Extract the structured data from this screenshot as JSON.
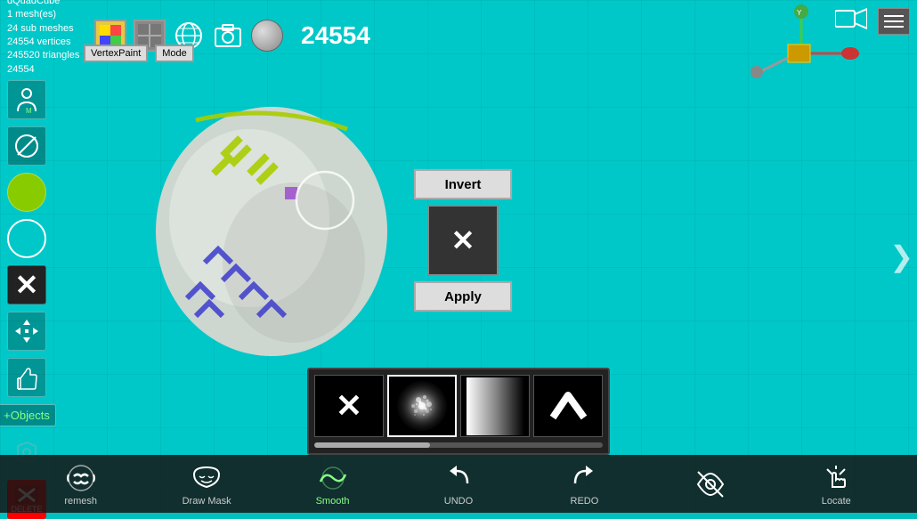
{
  "app": {
    "title": "dQuadCube",
    "mesh_count": "1 mesh(es)",
    "sub_meshes": "24 sub meshes",
    "vertices": "24554 vertices",
    "triangles": "245520 triangles",
    "vertex_count_bottom": "24554",
    "object_count": "24554"
  },
  "toolbar": {
    "vertex_paint_label": "VertexPaint",
    "mode_label": "Mode"
  },
  "invert_panel": {
    "invert_label": "Invert",
    "apply_label": "Apply"
  },
  "brush_panel": {
    "progress_value": 40
  },
  "bottom_toolbar": {
    "remesh_label": "remesh",
    "draw_mask_label": "Draw Mask",
    "smooth_label": "Smooth",
    "undo_label": "UNDO",
    "redo_label": "REDO",
    "locate_label": "Locate"
  }
}
